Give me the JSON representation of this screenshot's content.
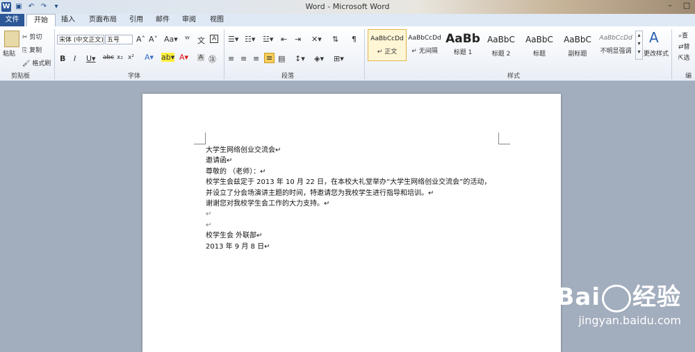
{
  "window": {
    "title": "Word  -  Microsoft Word",
    "minimize": "–",
    "maximize": "□"
  },
  "qat": {
    "logo": "W",
    "save": "▣",
    "undo": "↶",
    "redo": "↷",
    "dropdown": "▾"
  },
  "tabs": [
    {
      "label": "文件"
    },
    {
      "label": "开始"
    },
    {
      "label": "插入"
    },
    {
      "label": "页面布局"
    },
    {
      "label": "引用"
    },
    {
      "label": "邮件"
    },
    {
      "label": "审阅"
    },
    {
      "label": "视图"
    }
  ],
  "clipboard": {
    "paste": "粘贴",
    "cut": "剪切",
    "copy": "复制",
    "format_painter": "格式刷",
    "group": "剪贴板"
  },
  "font": {
    "name": "宋体 (中文正文)",
    "size": "五号",
    "group": "字体"
  },
  "paragraph": {
    "group": "段落"
  },
  "styles": {
    "group": "样式",
    "change": "更改样式",
    "items": [
      {
        "sample": "AaBbCcDd",
        "name": "↵ 正文"
      },
      {
        "sample": "AaBbCcDd",
        "name": "↵ 无间隔"
      },
      {
        "sample": "AaBb",
        "name": "标题 1"
      },
      {
        "sample": "AaBbC",
        "name": "标题 2"
      },
      {
        "sample": "AaBbC",
        "name": "标题"
      },
      {
        "sample": "AaBbC",
        "name": "副标题"
      },
      {
        "sample": "AaBbCcDd",
        "name": "不明显强调"
      }
    ]
  },
  "editing": {
    "group": "编",
    "find": "查",
    "replace": "替",
    "select": "选"
  },
  "document": {
    "lines": [
      "大学生网络创业交流会↵",
      "邀请函↵",
      "尊敬的          （老师）：↵",
      "校学生会兹定于 2013 年 10 月 22 日，在本校大礼堂举办“大学生网络创业交流会”的活动，",
      "并设立了分会场演讲主题的时间，特邀请您为我校学生进行指导和培训。↵",
      "谢谢您对我校学生会工作的大力支持。↵",
      "↵",
      "↵",
      "校学生会  外联部↵",
      "2013 年 9 月 8 日↵"
    ]
  },
  "watermark": {
    "brand_left": "Bai",
    "brand_right": "经验",
    "url": "jingyan.baidu.com"
  }
}
